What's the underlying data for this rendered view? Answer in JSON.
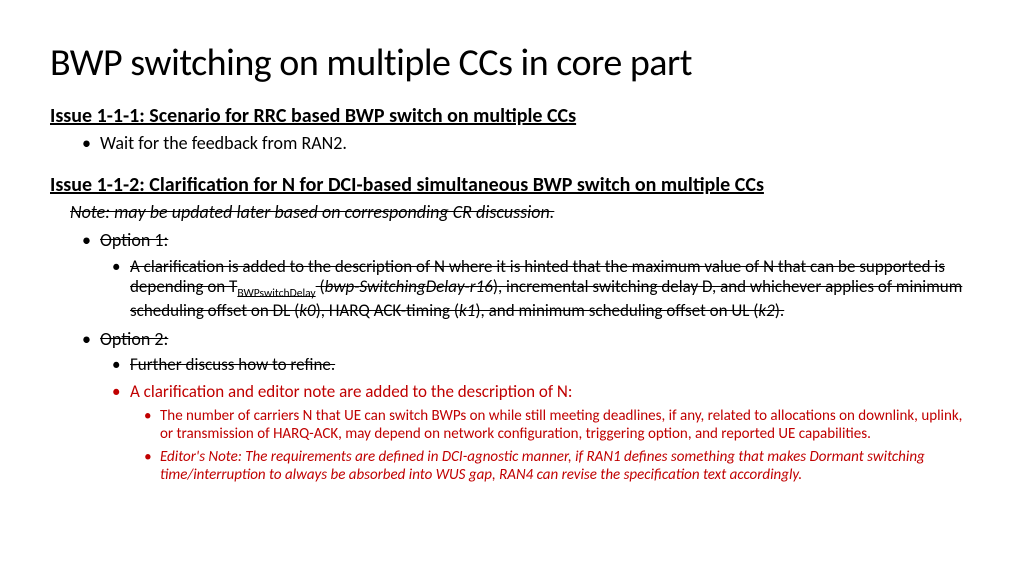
{
  "title": "BWP switching on multiple CCs in core part",
  "issue1": {
    "heading": "Issue 1-1-1: Scenario for RRC based BWP switch on multiple CCs",
    "bullet": "Wait for the feedback from RAN2."
  },
  "issue2": {
    "heading": "Issue 1-1-2: Clarification for N for DCI-based simultaneous BWP switch on multiple CCs",
    "note": "Note: may be updated later based on corresponding CR discussion.",
    "option1_label": "Option 1:",
    "option1_pre": "A clarification is added to the description of N where it is hinted that the maximum value of N that can be supported is depending on T",
    "option1_sub": "BWPswitchDelay",
    "option1_mid1": " (",
    "option1_em1": "bwp-SwitchingDelay-r16",
    "option1_mid2": "), incremental switching delay D, and whichever applies of minimum scheduling offset on DL (",
    "option1_em2": "k0",
    "option1_mid3": "), HARQ ACK-timing (",
    "option1_em3": "k1",
    "option1_mid4": "), and minimum scheduling offset on UL (",
    "option1_em4": "k2",
    "option1_end": ").",
    "option2_label": "Option 2:",
    "option2_struck": "Further discuss how to refine.",
    "option2_red_lead": "A clarification and editor note are added to the description of N:",
    "option2_red_sub1": "The number of carriers N that UE can switch BWPs on while still meeting deadlines, if any, related to allocations on downlink, uplink, or transmission of HARQ-ACK, may depend on network configuration, triggering option, and reported UE capabilities.",
    "option2_red_sub2": "Editor's Note: The requirements are defined in DCI-agnostic manner, if RAN1 defines something that makes Dormant switching time/interruption to always be absorbed into WUS gap, RAN4 can revise the specification text accordingly."
  }
}
